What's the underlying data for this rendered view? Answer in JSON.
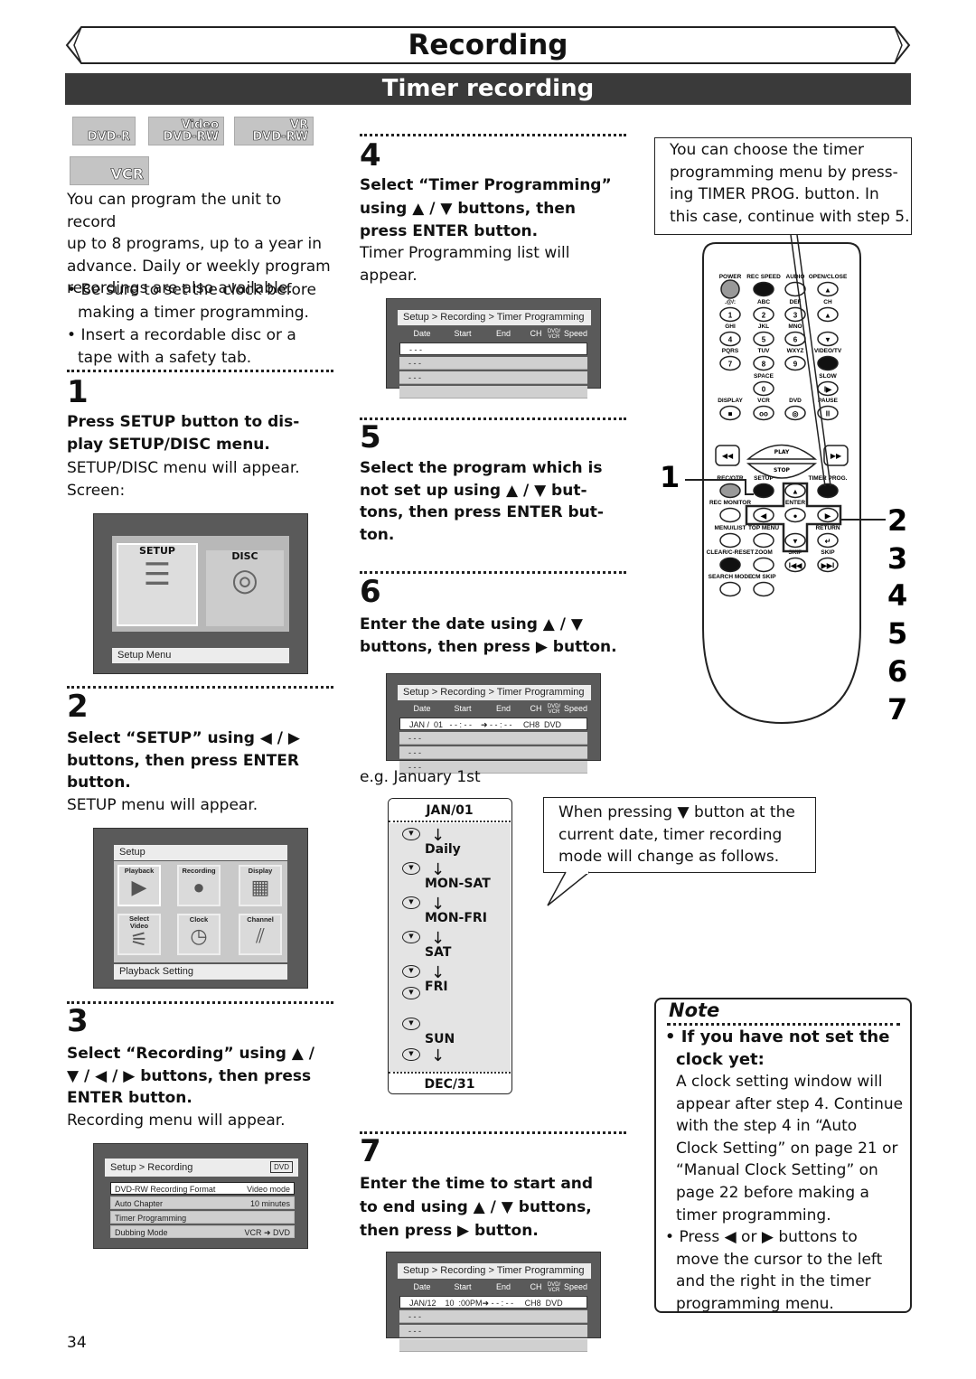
{
  "header": {
    "chapter_title": "Recording",
    "section_title": "Timer recording"
  },
  "media_logos": [
    {
      "icon": "dvd-r-logo",
      "label": "DVD-R",
      "sub": ""
    },
    {
      "icon": "dvd-rw-video-logo",
      "label": "DVD-RW",
      "sub": "Video"
    },
    {
      "icon": "dvd-rw-vr-logo",
      "label": "DVD-RW",
      "sub": "VR"
    },
    {
      "icon": "vcr-logo",
      "label": "VCR",
      "sub": ""
    }
  ],
  "intro": {
    "text": "You can program the unit to record\nup to 8 programs, up to a year in\nadvance. Daily or weekly program\nrecordings are also available.",
    "bullets": [
      "Be sure to set the clock before\nmaking a timer programming.",
      "Insert a recordable disc or a\ntape with a safety tab."
    ]
  },
  "steps": [
    {
      "num": "1",
      "instruction": "Press SETUP button to dis-\nplay SETUP/DISC menu.",
      "result": "SETUP/DISC menu will appear.\n    Screen:"
    },
    {
      "num": "2",
      "instruction": "Select “SETUP” using ◀ / ▶\nbuttons, then press ENTER\nbutton.",
      "result": "SETUP menu will appear."
    },
    {
      "num": "3",
      "instruction": "Select “Recording” using ▲ /\n▼ / ◀ / ▶ buttons, then press\nENTER button.",
      "result": "Recording menu will appear."
    },
    {
      "num": "4",
      "instruction": "Select “Timer Programming”\nusing ▲ / ▼ buttons, then\npress ENTER button.",
      "result": "Timer Programming list will\nappear."
    },
    {
      "num": "5",
      "instruction": "Select the program which is\nnot set up using ▲ / ▼ but-\ntons, then press ENTER but-\nton.",
      "result": ""
    },
    {
      "num": "6",
      "instruction": "Enter the date using ▲ / ▼\nbuttons, then press ▶ button.",
      "result": "e.g. January 1st"
    },
    {
      "num": "7",
      "instruction": "Enter the time to start and\nto end using ▲ / ▼ buttons,\nthen press ▶ button.",
      "result": ""
    }
  ],
  "screens": {
    "setup_disc": {
      "tab_setup": "SETUP",
      "tab_disc": "DISC",
      "status": "Setup Menu"
    },
    "setup": {
      "title": "Setup",
      "tiles": [
        "Playback",
        "Recording",
        "Display",
        "Select\nVideo",
        "Clock",
        "Channel"
      ],
      "status": "Playback Setting"
    },
    "recording": {
      "title": "Setup > Recording",
      "badge": "DVD",
      "rows": [
        {
          "label": "DVD-RW Recording Format",
          "value": "Video mode"
        },
        {
          "label": "Auto Chapter",
          "value": "10 minutes"
        },
        {
          "label": "Timer Programming",
          "value": ""
        },
        {
          "label": "Dubbing Mode",
          "value": "VCR ➜ DVD"
        }
      ]
    },
    "timer_columns": [
      "Date",
      "Start",
      "End",
      "CH",
      "DVD/VCR",
      "Speed"
    ],
    "timer_title": "Setup > Recording > Timer Programming",
    "timer_list": {
      "rows": [
        "- - -",
        "- - -",
        "- - -",
        ""
      ]
    },
    "timer_date": {
      "rows": [
        "JAN / [01]  - - : - -    ➜ - - : - -     CH8  DVD",
        "- - -",
        "- - -",
        "- - -"
      ]
    },
    "timer_time": {
      "rows": [
        "JAN/12   [10] :00PM➜ - - : - -     CH8  DVD",
        "- - -",
        "- - -",
        ""
      ]
    }
  },
  "date_flow": {
    "start": "JAN/01",
    "items": [
      "Daily",
      "MON-SAT",
      "MON-FRI",
      "SAT",
      "FRI",
      "SUN"
    ],
    "end": "DEC/31",
    "button_icon": "down-arrow-button-icon"
  },
  "callout": "When pressing ▼ button at the\ncurrent date, timer recording\nmode will change as follows.",
  "remote_tip": "You can choose the timer\nprogramming menu by press-\ning TIMER PROG. button. In\nthis case, continue with step 5.",
  "remote": {
    "rows": [
      [
        [
          "POWER",
          ""
        ],
        [
          "REC SPEED",
          ""
        ],
        [
          "AUDIO",
          ""
        ],
        [
          "OPEN/CLOSE",
          "▲"
        ]
      ],
      [
        [
          ".@/:",
          "1"
        ],
        [
          "ABC",
          "2"
        ],
        [
          "DEF",
          "3"
        ],
        [
          "CH",
          "▲"
        ]
      ],
      [
        [
          "GHI",
          "4"
        ],
        [
          "JKL",
          "5"
        ],
        [
          "MNO",
          "6"
        ],
        [
          "",
          "▼"
        ]
      ],
      [
        [
          "PQRS",
          "7"
        ],
        [
          "TUV",
          "8"
        ],
        [
          "WXYZ",
          "9"
        ],
        [
          "VIDEO/TV",
          ""
        ]
      ],
      [
        [
          "",
          ""
        ],
        [
          "SPACE",
          "0"
        ],
        [
          "",
          ""
        ],
        [
          "SLOW",
          "I▶"
        ]
      ],
      [
        [
          "DISPLAY",
          "■"
        ],
        [
          "VCR",
          "oo"
        ],
        [
          "DVD",
          "◎"
        ],
        [
          "PAUSE",
          "II"
        ]
      ],
      [
        [
          "REC/OTR",
          ""
        ],
        [
          "SETUP",
          ""
        ],
        [
          "",
          "▲"
        ],
        [
          "TIMER PROG.",
          ""
        ]
      ],
      [
        [
          "REC MONITOR",
          ""
        ],
        [
          "",
          "◀"
        ],
        [
          "ENTER",
          "●"
        ],
        [
          "",
          "▶"
        ]
      ],
      [
        [
          "MENU/LIST",
          ""
        ],
        [
          "TOP MENU",
          ""
        ],
        [
          "",
          "▼"
        ],
        [
          "RETURN",
          "↵"
        ]
      ],
      [
        [
          "CLEAR/C-RESET",
          ""
        ],
        [
          "ZOOM",
          ""
        ],
        [
          "SKIP",
          "I◀◀"
        ],
        [
          "SKIP",
          "▶▶I"
        ]
      ],
      [
        [
          "SEARCH MODE",
          ""
        ],
        [
          "CM SKIP",
          ""
        ],
        [
          "",
          ""
        ],
        [
          "",
          ""
        ]
      ]
    ],
    "play": "PLAY",
    "stop": "STOP",
    "callout_numbers": [
      "1",
      "2",
      "3",
      "4",
      "5",
      "6",
      "7"
    ]
  },
  "note": {
    "title": "Note",
    "items": [
      {
        "heading": "If you have not set the\nclock yet:",
        "text": "A clock setting window will\nappear after step 4.  Continue\nwith the step 4 in “Auto\nClock Setting” on page 21 or\n“Manual Clock Setting” on\npage 22 before making a\ntimer programming."
      },
      {
        "heading": "",
        "text": "Press ◀ or ▶ buttons to\nmove the cursor to the left\nand the right in the timer\nprogramming menu."
      }
    ]
  },
  "page_number": "34"
}
